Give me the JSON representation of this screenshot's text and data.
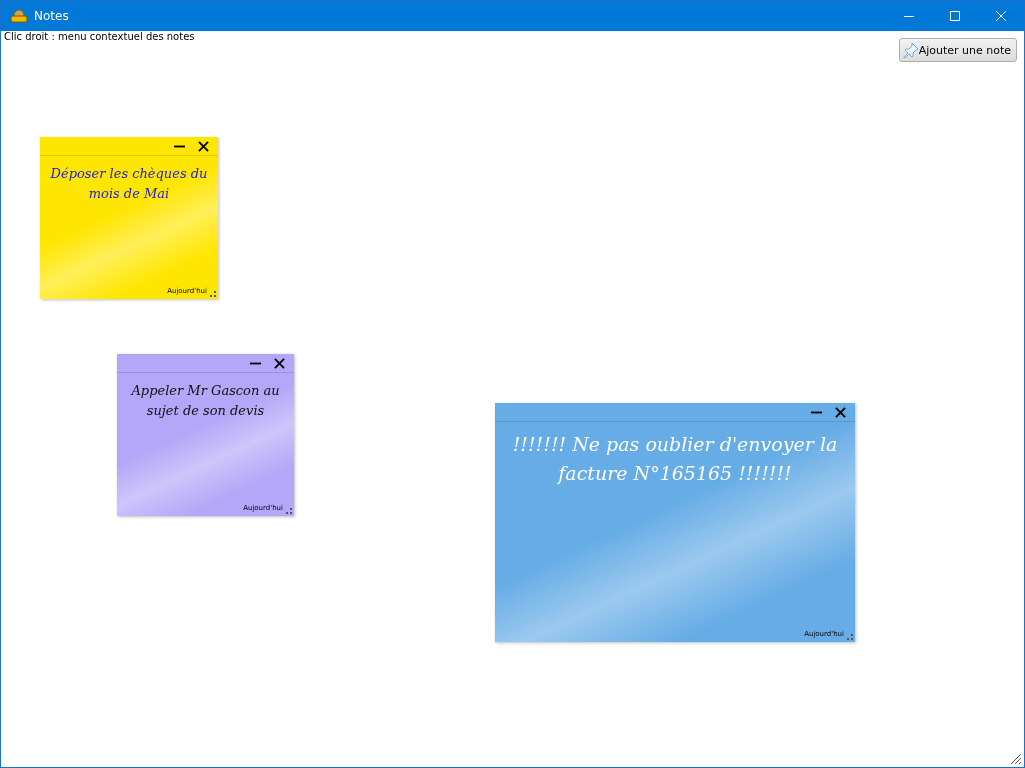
{
  "window": {
    "title": "Notes"
  },
  "hint": "Clic droit : menu contextuel des notes",
  "add_button": {
    "label": "Ajouter une note"
  },
  "notes": [
    {
      "text": "Déposer les chèques du mois de Mai",
      "date": "Aujourd'hui",
      "color": "#ffe600",
      "kind": "blue-ink"
    },
    {
      "text": "Appeler Mr Gascon au sujet de son devis",
      "date": "Aujourd'hui",
      "color": "#b4a6f8",
      "kind": "dark-ink"
    },
    {
      "text": "!!!!!!! Ne pas oublier d'envoyer la facture N°165165 !!!!!!!",
      "date": "Aujourd'hui",
      "color": "#66ace6",
      "kind": "light-ink"
    }
  ]
}
